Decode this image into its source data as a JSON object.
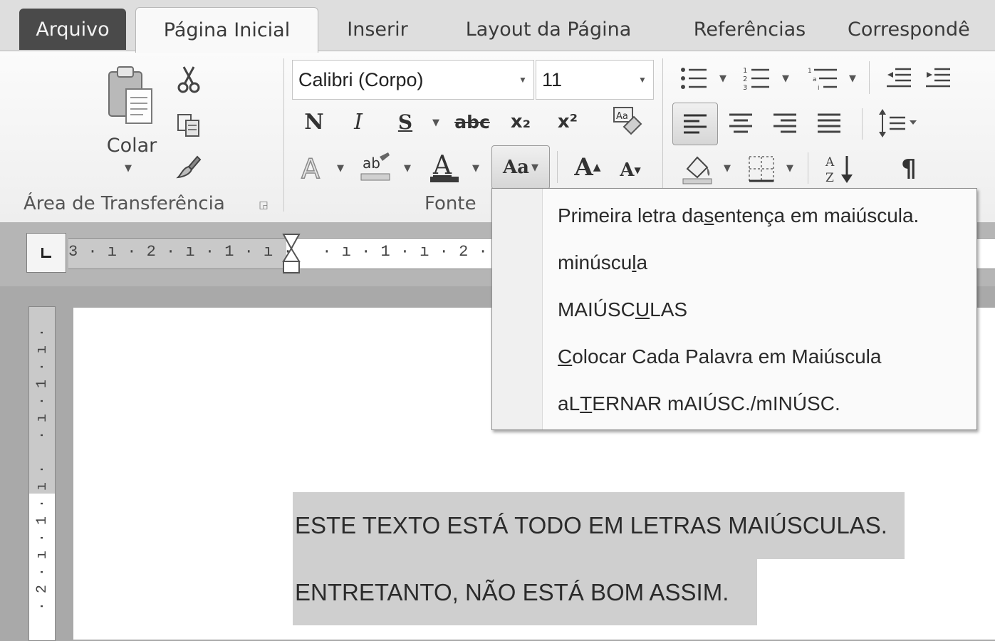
{
  "tabs": {
    "file": "Arquivo",
    "home": "Página Inicial",
    "insert": "Inserir",
    "layout": "Layout da Página",
    "references": "Referências",
    "mailings": "Correspondê"
  },
  "clipboard": {
    "paste_label": "Colar",
    "group_label": "Área de Transferência"
  },
  "font": {
    "font_name": "Calibri (Corpo)",
    "font_size": "11",
    "bold_glyph": "N",
    "italic_glyph": "I",
    "underline_glyph": "S",
    "strike_glyph": "abc",
    "subscript_glyph": "x₂",
    "superscript_glyph": "x²",
    "change_case_glyph": "Aa",
    "grow_glyph": "A",
    "shrink_glyph": "A",
    "group_label": "Fonte"
  },
  "paragraph": {
    "pilcrow_glyph": "¶"
  },
  "ruler": {
    "horizontal_text": "3 · ı · 2 · ı · 1 · ı ·   · ı · 1 · ı · 2 · ı",
    "vertical_text": "· 2 · ı · 1 · ı ·   · ı · 1 · ı ·"
  },
  "change_case_menu": {
    "items": [
      {
        "pre": "Primeira letra da ",
        "accel": "s",
        "post": "entença em maiúscula."
      },
      {
        "pre": "minúscu",
        "accel": "l",
        "post": "a"
      },
      {
        "pre": "MAIÚSC",
        "accel": "U",
        "post": "LAS"
      },
      {
        "pre": "",
        "accel": "C",
        "post": "olocar Cada Palavra em Maiúscula"
      },
      {
        "pre": "aL",
        "accel": "T",
        "post": "ERNAR mAIÚSC./mINÚSC."
      }
    ]
  },
  "document": {
    "line1": "ESTE TEXTO ESTÁ TODO EM LETRAS MAIÚSCULAS.",
    "line2": "ENTRETANTO, NÃO ESTÁ BOM ASSIM."
  },
  "colors": {
    "selection": "#cfcfcf",
    "file_tab": "#4a4a4a"
  }
}
